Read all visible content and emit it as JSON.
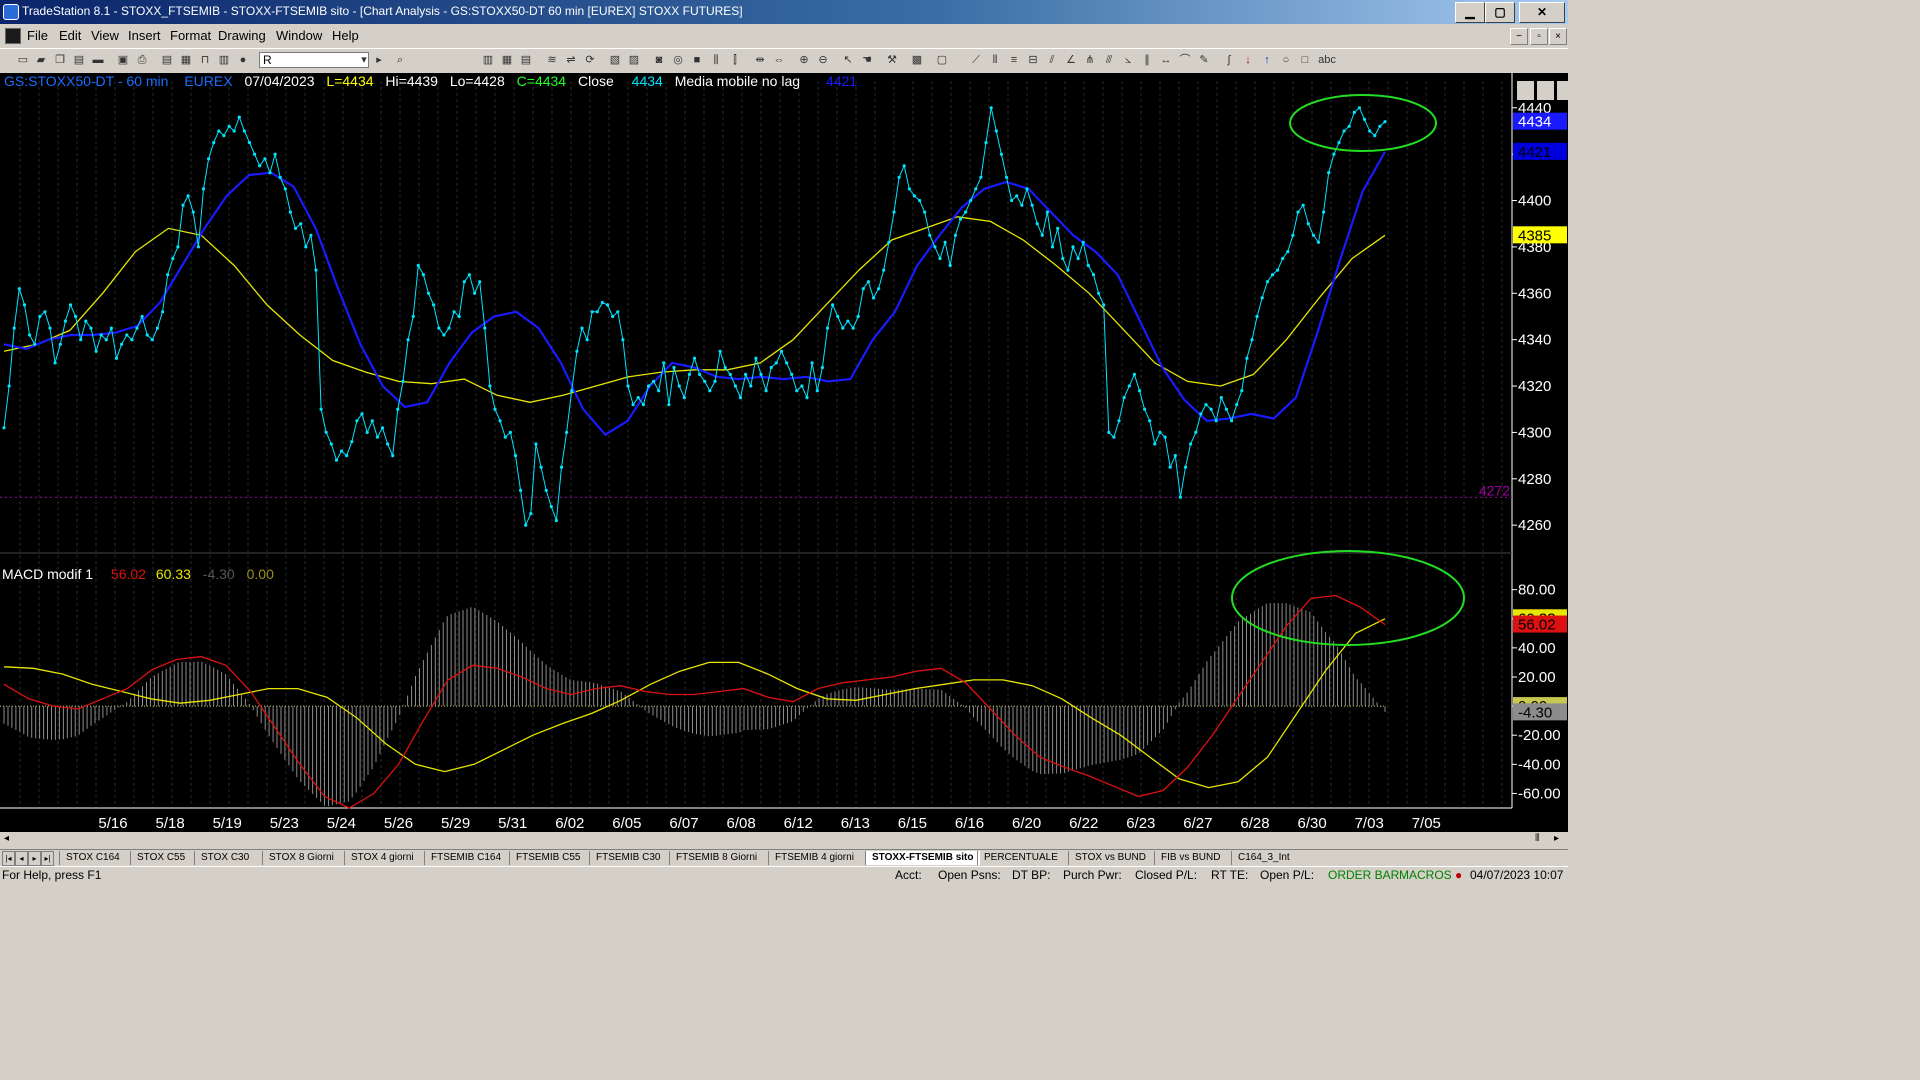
{
  "window": {
    "title": "TradeStation 8.1 - STOXX_FTSEMIB - STOXX-FTSEMIB sito - [Chart Analysis - GS:STOXX50-DT  60 min  [EUREX] STOXX FUTURES]",
    "btn_min": "▁",
    "btn_max": "▢",
    "btn_close": "✕"
  },
  "menu": {
    "items": [
      "File",
      "Edit",
      "View",
      "Insert",
      "Format",
      "Drawing",
      "Window",
      "Help"
    ]
  },
  "toolbar": {
    "symbol_value": "R"
  },
  "chart_header": {
    "symbol": "GS:STOXX50-DT - 60 min",
    "exchange": "EUREX",
    "date": "07/04/2023",
    "last": "L=4434",
    "high": "Hi=4439",
    "low": "Lo=4428",
    "close": "C=4434",
    "close_label": "Close",
    "close_value": "4434",
    "indicator_name": "Media mobile no lag",
    "indicator_value": "4421"
  },
  "macd_header": {
    "name": "MACD modif 1",
    "v1": "56.02",
    "v2": "60.33",
    "v3": "-4.30",
    "v4": "0.00"
  },
  "colors": {
    "background": "#000000",
    "price": "#00e5ff",
    "fast_ma": "#1a1aff",
    "slow_ma": "#e6e600",
    "macd": "#dd1111",
    "signal": "#e6e600",
    "histogram": "#8c8c8c",
    "highlight_ellipse": "#22dd22",
    "support_line": "#a000a0"
  },
  "chart_data": [
    {
      "type": "line",
      "title": "GS:STOXX50-DT - 60 min",
      "x_tick_labels": [
        "5/16",
        "5/18",
        "5/19",
        "5/23",
        "5/24",
        "5/26",
        "5/29",
        "5/31",
        "6/02",
        "6/05",
        "6/07",
        "6/08",
        "6/12",
        "6/13",
        "6/15",
        "6/16",
        "6/20",
        "6/22",
        "6/23",
        "6/27",
        "6/28",
        "6/30",
        "7/03",
        "7/05"
      ],
      "y_tick_labels": [
        "4440",
        "4420",
        "4400",
        "4380",
        "4360",
        "4340",
        "4320",
        "4300",
        "4280",
        "4260"
      ],
      "ylim": [
        4248,
        4455
      ],
      "price_tags": [
        {
          "value": "4434",
          "kind": "close"
        },
        {
          "value": "4421",
          "kind": "fast_ma"
        },
        {
          "value": "4385",
          "kind": "slow_ma"
        }
      ],
      "support_level": {
        "value": 4272,
        "label": "4272"
      },
      "series": [
        {
          "name": "Close",
          "role": "price",
          "values": [
            4302,
            4320,
            4345,
            4362,
            4355,
            4342,
            4338,
            4350,
            4352,
            4345,
            4330,
            4338,
            4348,
            4355,
            4350,
            4340,
            4348,
            4345,
            4335,
            4342,
            4340,
            4345,
            4332,
            4338,
            4342,
            4340,
            4345,
            4350,
            4342,
            4340,
            4345,
            4352,
            4368,
            4375,
            4380,
            4398,
            4402,
            4395,
            4380,
            4405,
            4418,
            4425,
            4430,
            4428,
            4432,
            4430,
            4436,
            4430,
            4425,
            4420,
            4415,
            4418,
            4412,
            4420,
            4410,
            4405,
            4395,
            4388,
            4390,
            4380,
            4385,
            4370,
            4310,
            4300,
            4295,
            4288,
            4292,
            4290,
            4296,
            4305,
            4308,
            4300,
            4305,
            4298,
            4302,
            4295,
            4290,
            4310,
            4322,
            4340,
            4350,
            4372,
            4368,
            4360,
            4355,
            4345,
            4342,
            4345,
            4352,
            4350,
            4365,
            4368,
            4360,
            4365,
            4345,
            4320,
            4310,
            4305,
            4298,
            4300,
            4290,
            4275,
            4260,
            4265,
            4295,
            4285,
            4275,
            4268,
            4262,
            4285,
            4300,
            4318,
            4335,
            4345,
            4340,
            4352,
            4352,
            4356,
            4355,
            4350,
            4352,
            4340,
            4320,
            4312,
            4315,
            4312,
            4320,
            4322,
            4318,
            4330,
            4312,
            4328,
            4320,
            4315,
            4325,
            4332,
            4325,
            4322,
            4318,
            4322,
            4335,
            4328,
            4325,
            4320,
            4315,
            4325,
            4320,
            4332,
            4325,
            4318,
            4328,
            4330,
            4335,
            4330,
            4325,
            4318,
            4320,
            4315,
            4330,
            4318,
            4328,
            4345,
            4355,
            4350,
            4345,
            4348,
            4345,
            4350,
            4362,
            4365,
            4358,
            4362,
            4370,
            4382,
            4395,
            4410,
            4415,
            4405,
            4402,
            4400,
            4395,
            4385,
            4380,
            4375,
            4382,
            4372,
            4385,
            4392,
            4395,
            4400,
            4405,
            4410,
            4425,
            4440,
            4430,
            4420,
            4410,
            4400,
            4402,
            4398,
            4405,
            4398,
            4390,
            4385,
            4395,
            4380,
            4388,
            4375,
            4370,
            4380,
            4375,
            4382,
            4372,
            4368,
            4360,
            4355,
            4300,
            4298,
            4305,
            4315,
            4320,
            4325,
            4318,
            4310,
            4305,
            4295,
            4300,
            4298,
            4285,
            4290,
            4272,
            4285,
            4295,
            4300,
            4308,
            4312,
            4310,
            4305,
            4315,
            4310,
            4305,
            4312,
            4318,
            4332,
            4340,
            4350,
            4358,
            4365,
            4368,
            4370,
            4375,
            4378,
            4385,
            4395,
            4398,
            4390,
            4385,
            4382,
            4395,
            4412,
            4420,
            4425,
            4430,
            4432,
            4438,
            4440,
            4435,
            4430,
            4428,
            4432,
            4434
          ]
        },
        {
          "name": "Media mobile no lag",
          "role": "fast_ma",
          "values": [
            4338,
            4336,
            4340,
            4342,
            4342,
            4343,
            4346,
            4356,
            4372,
            4388,
            4402,
            4411,
            4412,
            4406,
            4388,
            4362,
            4338,
            4320,
            4311,
            4313,
            4330,
            4343,
            4350,
            4352,
            4345,
            4330,
            4310,
            4299,
            4305,
            4320,
            4330,
            4328,
            4324,
            4323,
            4324,
            4323,
            4324,
            4322,
            4323,
            4340,
            4352,
            4372,
            4385,
            4397,
            4405,
            4408,
            4405,
            4395,
            4385,
            4378,
            4368,
            4348,
            4328,
            4314,
            4305,
            4306,
            4308,
            4306,
            4315,
            4344,
            4375,
            4404,
            4421
          ]
        },
        {
          "name": "MA slow",
          "role": "slow_ma",
          "values": [
            4335,
            4338,
            4344,
            4360,
            4378,
            4388,
            4385,
            4372,
            4355,
            4342,
            4331,
            4326,
            4322,
            4321,
            4323,
            4316,
            4313,
            4316,
            4320,
            4324,
            4326,
            4327,
            4327,
            4330,
            4340,
            4355,
            4370,
            4383,
            4388,
            4393,
            4391,
            4383,
            4372,
            4360,
            4345,
            4330,
            4322,
            4320,
            4325,
            4340,
            4358,
            4375,
            4385
          ]
        }
      ]
    },
    {
      "type": "line",
      "title": "MACD modif 1",
      "y_tick_labels": [
        "80.00",
        "60.00",
        "40.00",
        "20.00",
        "0.00",
        "-20.00",
        "-40.00",
        "-60.00"
      ],
      "ylim": [
        -70,
        88
      ],
      "price_tags": [
        {
          "value": "60.33",
          "kind": "signal"
        },
        {
          "value": "56.02",
          "kind": "macd"
        },
        {
          "value": "0.00",
          "kind": "zero"
        },
        {
          "value": "-4.30",
          "kind": "histogram"
        }
      ],
      "series": [
        {
          "name": "MACD",
          "role": "macd",
          "values": [
            15,
            5,
            0,
            -2,
            5,
            12,
            25,
            32,
            34,
            28,
            10,
            -15,
            -40,
            -62,
            -70,
            -60,
            -40,
            -10,
            18,
            28,
            26,
            20,
            12,
            8,
            12,
            14,
            10,
            8,
            8,
            10,
            12,
            6,
            3,
            12,
            16,
            18,
            20,
            24,
            26,
            16,
            -2,
            -20,
            -35,
            -42,
            -48,
            -55,
            -62,
            -58,
            -42,
            -20,
            5,
            30,
            55,
            74,
            76,
            68,
            56
          ]
        },
        {
          "name": "Signal",
          "role": "signal",
          "values": [
            27,
            26,
            22,
            15,
            10,
            5,
            2,
            4,
            8,
            12,
            12,
            6,
            -8,
            -26,
            -40,
            -45,
            -40,
            -30,
            -20,
            -12,
            -5,
            4,
            15,
            24,
            30,
            30,
            22,
            12,
            5,
            4,
            8,
            12,
            15,
            18,
            18,
            14,
            5,
            -8,
            -20,
            -35,
            -50,
            -56,
            -52,
            -35,
            -5,
            25,
            50,
            60
          ]
        }
      ]
    }
  ],
  "tabs": [
    "STOX C164",
    "STOX C55",
    "STOX  C30",
    "STOX  8 Giorni",
    "STOX 4 giorni",
    "FTSEMIB C164",
    "FTSEMIB C55",
    "FTSEMIB C30",
    "FTSEMIB  8 Giorni",
    "FTSEMIB  4 giorni",
    "STOXX-FTSEMIB sito",
    "PERCENTUALE",
    "STOX vs BUND",
    "FIB vs BUND",
    "C164_3_Int"
  ],
  "status": {
    "help": "For Help, press F1",
    "acct": "Acct:",
    "open_psns": "Open Psns:",
    "dt_bp": "DT BP:",
    "purch_pwr": "Purch Pwr:",
    "closed_pl": "Closed P/L:",
    "rt_te": "RT TE:",
    "open_pl": "Open P/L:",
    "order_bar": "ORDER BAR",
    "macros": "MACROS",
    "datetime": "04/07/2023 10:07"
  }
}
